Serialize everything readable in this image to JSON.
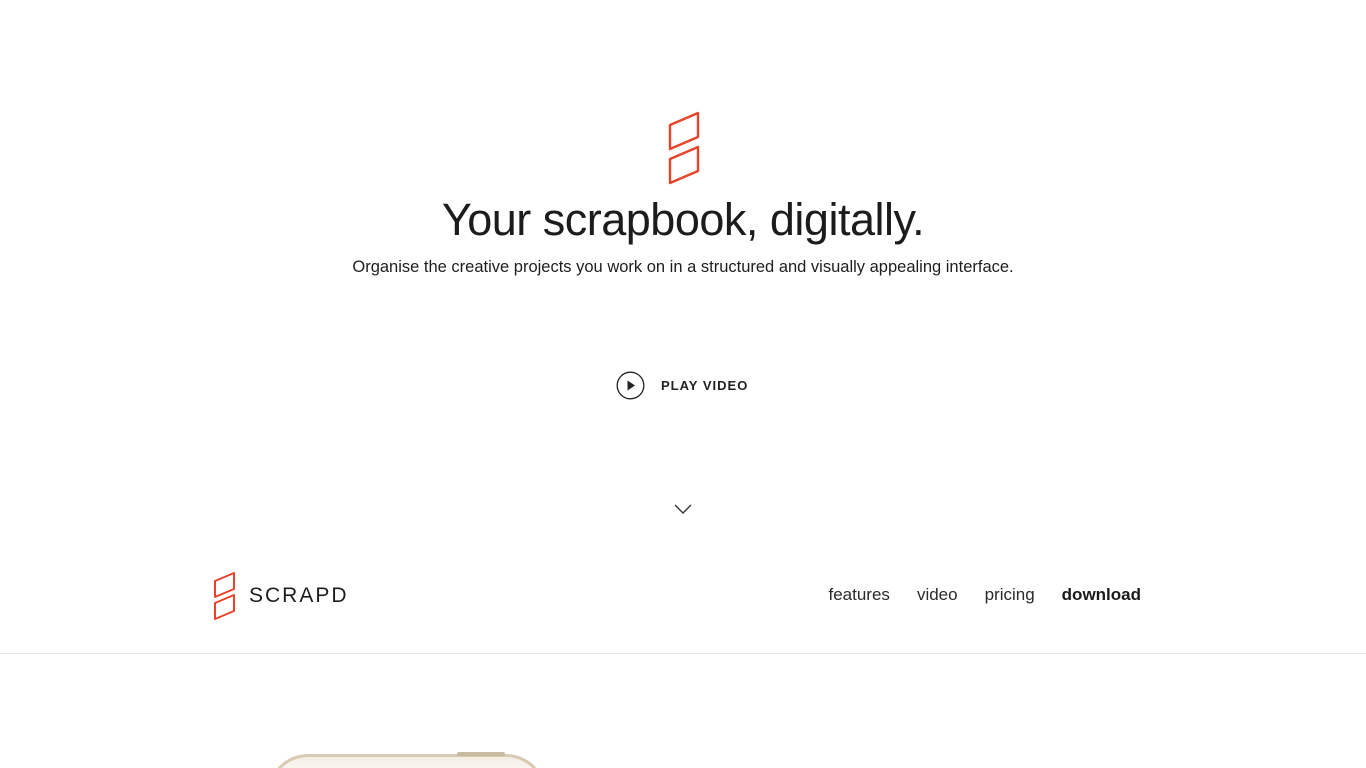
{
  "brand": {
    "name": "SCRAPD",
    "accent_color": "#e8442c"
  },
  "hero": {
    "logo_icon": "scrapd-logo-icon",
    "title": "Your scrapbook, digitally.",
    "subtitle": "Organise the creative projects you work on in a structured and visually appealing interface.",
    "play_icon": "play-circle-icon",
    "play_label": "PLAY VIDEO",
    "scroll_icon": "chevron-down-icon"
  },
  "nav": {
    "links": [
      {
        "label": "features"
      },
      {
        "label": "video"
      },
      {
        "label": "pricing"
      },
      {
        "label": "download"
      }
    ]
  }
}
